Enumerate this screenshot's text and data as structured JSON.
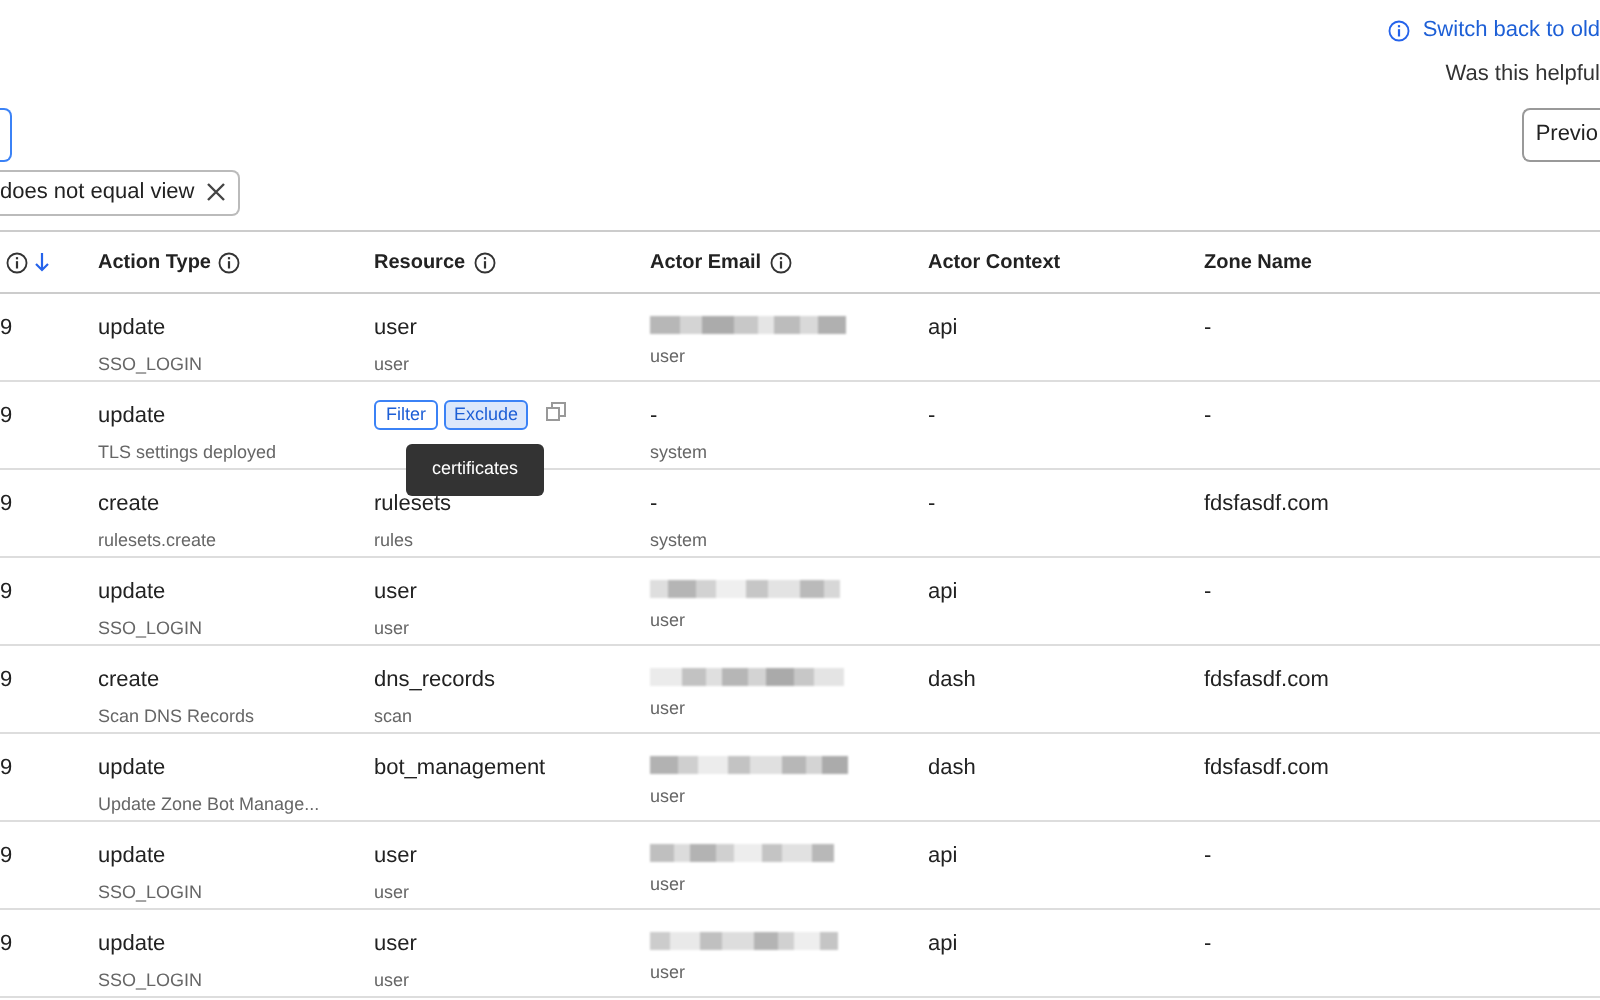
{
  "help_link": "Switch back to old",
  "feedback_prompt": "Was this helpful",
  "previous_button": "Previo",
  "filter_chip": {
    "label": "does not equal view"
  },
  "table": {
    "columns": [
      {
        "label": "Action Type",
        "info": true
      },
      {
        "label": "Resource",
        "info": true
      },
      {
        "label": "Actor Email",
        "info": true
      },
      {
        "label": "Actor Context",
        "info": false
      },
      {
        "label": "Zone Name",
        "info": false
      }
    ],
    "rows": [
      {
        "column_1": "9",
        "action": "update",
        "action_detail": "SSO_LOGIN",
        "resource": "user",
        "resource_detail": "user",
        "hovered": false,
        "email_blurred": true,
        "actor_email": "",
        "actor_type": "user",
        "actor_context": "api",
        "zone": "-"
      },
      {
        "column_1": "9",
        "action": "update",
        "action_detail": "TLS settings deployed",
        "hovered": true,
        "filter_button": "Filter",
        "exclude_button": "Exclude",
        "tooltip": "certificates",
        "email_blurred": false,
        "actor_email": "-",
        "actor_type": "system",
        "actor_context": "-",
        "zone": "-"
      },
      {
        "column_1": "9",
        "action": "create",
        "action_detail": "rulesets.create",
        "resource": "rulesets",
        "resource_detail": "rules",
        "hovered": false,
        "email_blurred": false,
        "actor_email": "-",
        "actor_type": "system",
        "actor_context": "-",
        "zone": "fdsfasdf.com"
      },
      {
        "column_1": "9",
        "action": "update",
        "action_detail": "SSO_LOGIN",
        "resource": "user",
        "resource_detail": "user",
        "hovered": false,
        "email_blurred": true,
        "actor_email": "",
        "actor_type": "user",
        "actor_context": "api",
        "zone": "-"
      },
      {
        "column_1": "9",
        "action": "create",
        "action_detail": "Scan DNS Records",
        "resource": "dns_records",
        "resource_detail": "scan",
        "hovered": false,
        "email_blurred": true,
        "actor_email": "",
        "actor_type": "user",
        "actor_context": "dash",
        "zone": "fdsfasdf.com"
      },
      {
        "column_1": "9",
        "action": "update",
        "action_detail": "Update Zone Bot Manage...",
        "resource": "bot_management",
        "resource_detail": "",
        "hovered": false,
        "email_blurred": true,
        "actor_email": "",
        "actor_type": "user",
        "actor_context": "dash",
        "zone": "fdsfasdf.com"
      },
      {
        "column_1": "9",
        "action": "update",
        "action_detail": "SSO_LOGIN",
        "resource": "user",
        "resource_detail": "user",
        "hovered": false,
        "email_blurred": true,
        "actor_email": "",
        "actor_type": "user",
        "actor_context": "api",
        "zone": "-"
      },
      {
        "column_1": "9",
        "action": "update",
        "action_detail": "SSO_LOGIN",
        "resource": "user",
        "resource_detail": "user",
        "hovered": false,
        "email_blurred": true,
        "actor_email": "",
        "actor_type": "user",
        "actor_context": "api",
        "zone": "-"
      }
    ]
  }
}
